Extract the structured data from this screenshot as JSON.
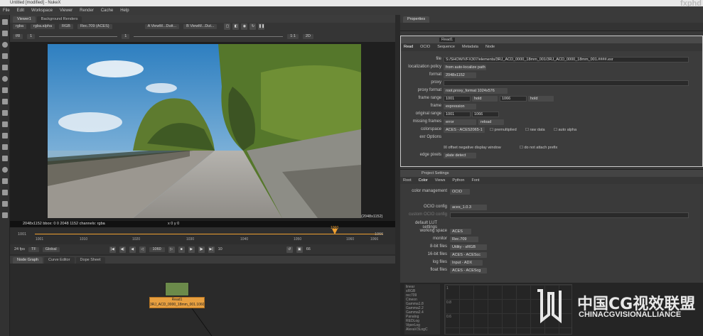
{
  "window": {
    "title": "Untitled [modified] - NukeX"
  },
  "menu": [
    "File",
    "Edit",
    "Workspace",
    "Viewer",
    "Render",
    "Cache",
    "Help"
  ],
  "viewer_tabs": [
    "Viewer1",
    "Background Renders"
  ],
  "properties_tab": "Properties",
  "viewer_controls": {
    "channels": "rgba",
    "alpha": "rgba.alpha",
    "display": "RGB",
    "colorspace": "Rec.709 (ACES)",
    "input_a": "A  ViewM...Dutt...",
    "input_b": "B  ViewM...Dut...",
    "fstop": "f/8",
    "frame_step": "1",
    "gain": "1",
    "gamma": "1",
    "zoom": "1:1",
    "mode": "2D"
  },
  "viewer_info": {
    "left": "2048x1152  bbox: 0 0 2048 1152  channels: rgba",
    "coords": "x 0  y 0",
    "format": "(2048x1152)"
  },
  "timeline": {
    "ticks": [
      "1001",
      "1010",
      "1020",
      "1030",
      "1040",
      "1050",
      "1060",
      "1066"
    ],
    "left_marker": "1001",
    "right_marker": "1066",
    "playhead": "1060"
  },
  "playback": {
    "fps": "24 fps",
    "tf": "TF",
    "global": "Global",
    "current_frame": "1060",
    "increment": "10",
    "end_frame": "66"
  },
  "node_tabs": [
    "Node Graph",
    "Curve Editor",
    "Dope Sheet"
  ],
  "node": {
    "name": "Read1",
    "file_label": "3RJ_ACD_0000_18mm_001.1060.exr"
  },
  "read_panel": {
    "node_name": "Read1",
    "tabs": [
      "Read",
      "OCIO",
      "Sequence",
      "Metadata",
      "Node"
    ],
    "rows": [
      {
        "label": "file",
        "value": "S:/SHOW/VFX307/elements/3RJ_ACD_0000_18mm_001/3RJ_ACD_0000_18mm_001.####.exr"
      },
      {
        "label": "localization policy",
        "value": "from auto-localize path"
      },
      {
        "label": "format",
        "value": "2048x1152"
      },
      {
        "label": "proxy",
        "value": ""
      },
      {
        "label": "proxy format",
        "value": "root.proxy_format 1024x576"
      },
      {
        "label": "frame range",
        "value": "1001",
        "value2": "hold",
        "value3": "1066",
        "value4": "hold"
      },
      {
        "label": "frame",
        "value": "expression"
      },
      {
        "label": "original range",
        "value": "1001",
        "value2": "1066"
      },
      {
        "label": "missing frames",
        "value": "error",
        "value2": "reload"
      },
      {
        "label": "colorspace",
        "value": "ACES - ACES2065-1",
        "check1": "premultiplied",
        "check2": "raw data",
        "check3": "auto alpha"
      },
      {
        "label": "exr Options",
        "value": ""
      },
      {
        "label": "",
        "check1": "offset negative display window",
        "check2": "do not attach prefix"
      },
      {
        "label": "edge pixels",
        "value": "plate detect"
      }
    ]
  },
  "project_panel": {
    "title": "Project Settings",
    "tabs": [
      "Root",
      "Color",
      "Views",
      "Python",
      "Font"
    ],
    "rows": [
      {
        "label": "color management",
        "value": "OCIO"
      },
      {
        "label": "OCIO config",
        "value": "aces_1.0.3"
      },
      {
        "label": "custom OCIO config",
        "value": ""
      },
      {
        "label": "default LUT settings",
        "value": ""
      },
      {
        "label": "working space",
        "value": "ACES"
      },
      {
        "label": "monitor",
        "value": "Rec.709"
      },
      {
        "label": "8-bit files",
        "value": "Utility - sRGB"
      },
      {
        "label": "16-bit files",
        "value": "ACES - ACEScc"
      },
      {
        "label": "log files",
        "value": "Input - ADX"
      },
      {
        "label": "float files",
        "value": "ACES - ACEScg"
      }
    ],
    "lut_list": [
      "linear",
      "sRGB",
      "rec709",
      "Cineon",
      "Gamma1.8",
      "Gamma2.2",
      "Gamma2.4",
      "Panalog",
      "REDLog",
      "ViperLog",
      "AlexaV3LogC"
    ],
    "graph_ticks": [
      "1",
      "0.8",
      "0.6"
    ]
  },
  "watermark": {
    "cn": "中国CG视效联盟",
    "en": "CHINACGVISIONALLIANCE",
    "corner": "fxphd"
  },
  "colors": {
    "accent": "#f0a030",
    "node": "#e8a040"
  }
}
